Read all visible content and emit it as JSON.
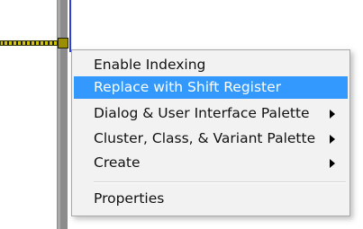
{
  "context_menu": {
    "items": [
      {
        "label": "Enable Indexing",
        "submenu": false,
        "selected": false
      },
      {
        "label": "Replace with Shift Register",
        "submenu": false,
        "selected": true
      },
      {
        "label": "Dialog & User Interface Palette",
        "submenu": true,
        "selected": false
      },
      {
        "label": "Cluster, Class, & Variant Palette",
        "submenu": true,
        "selected": false
      },
      {
        "label": "Create",
        "submenu": true,
        "selected": false
      },
      {
        "label": "Properties",
        "submenu": false,
        "selected": false
      }
    ],
    "highlight_color": "#3399ff"
  },
  "diagram": {
    "wire_color": "#d1c400",
    "frame_color": "#8c8c8c",
    "border_line_color": "#2a3fdc"
  }
}
